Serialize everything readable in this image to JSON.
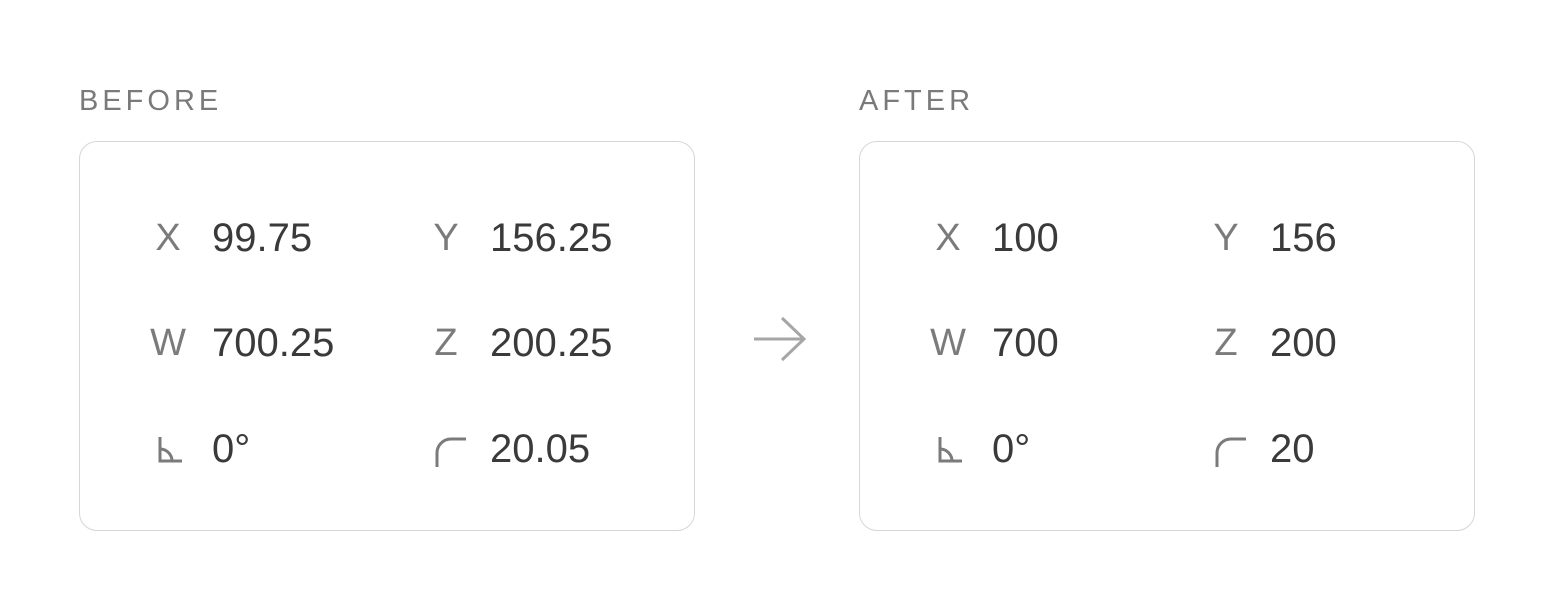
{
  "before": {
    "heading": "BEFORE",
    "x": {
      "label": "X",
      "value": "99.75"
    },
    "y": {
      "label": "Y",
      "value": "156.25"
    },
    "w": {
      "label": "W",
      "value": "700.25"
    },
    "z": {
      "label": "Z",
      "value": "200.25"
    },
    "rotation": {
      "icon": "angle-icon",
      "value": "0°"
    },
    "radius": {
      "icon": "corner-radius-icon",
      "value": "20.05"
    }
  },
  "after": {
    "heading": "AFTER",
    "x": {
      "label": "X",
      "value": "100"
    },
    "y": {
      "label": "Y",
      "value": "156"
    },
    "w": {
      "label": "W",
      "value": "700"
    },
    "z": {
      "label": "Z",
      "value": "200"
    },
    "rotation": {
      "icon": "angle-icon",
      "value": "0°"
    },
    "radius": {
      "icon": "corner-radius-icon",
      "value": "20"
    }
  },
  "transition_icon": "arrow-right-icon",
  "colors": {
    "heading": "#7a7a7a",
    "label": "#7b7b7b",
    "value": "#3a3a3a",
    "border": "#d6d6d6",
    "arrow": "#a6a6a6"
  }
}
